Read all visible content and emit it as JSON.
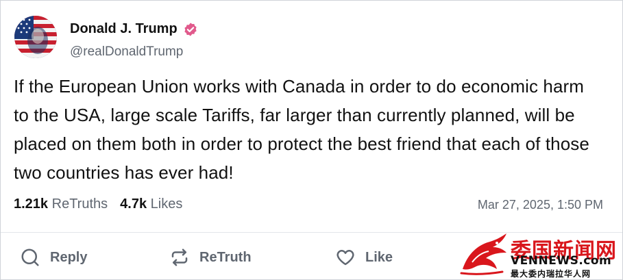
{
  "post": {
    "display_name": "Donald J. Trump",
    "handle": "@realDonaldTrump",
    "text": "If the European Union works with Canada in order to do economic harm to the USA, large scale Tariffs, far larger than currently planned, will be placed on them both in order to protect the best friend that each of those two countries has ever had!",
    "retruths_count": "1.21k",
    "retruths_label": "ReTruths",
    "likes_count": "4.7k",
    "likes_label": "Likes",
    "timestamp": "Mar 27, 2025, 1:50 PM",
    "verified_color": "#e15a8c"
  },
  "actions": {
    "reply_label": "Reply",
    "retruth_label": "ReTruth",
    "like_label": "Like"
  },
  "watermark": {
    "title": "委国新闻网",
    "site": "VENNEWS.com",
    "subtitle": "最大委内瑞拉华人网"
  }
}
